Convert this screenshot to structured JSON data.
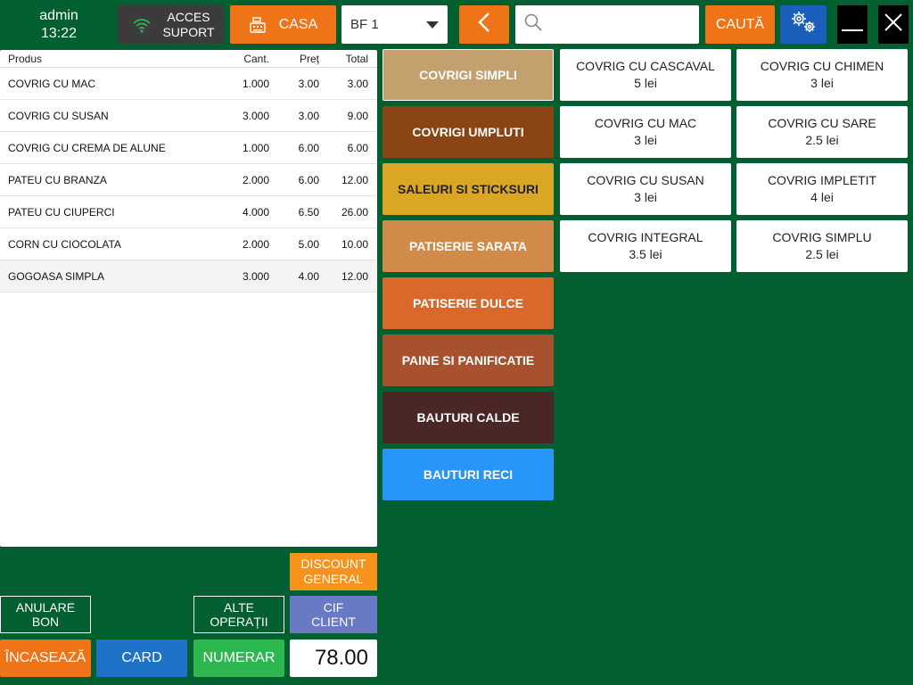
{
  "header": {
    "user": "admin",
    "time": "13:22",
    "acces_label_1": "ACCES",
    "acces_label_2": "SUPORT",
    "casa_label": "CASA",
    "bf_value": "BF 1",
    "search_placeholder": "",
    "search_label": "CAUTĂ"
  },
  "receipt": {
    "columns": {
      "product": "Produs",
      "qty": "Cant.",
      "price": "Preț",
      "total": "Total"
    },
    "rows": [
      {
        "name": "COVRIG CU MAC",
        "qty": "1.000",
        "price": "3.00",
        "total": "3.00"
      },
      {
        "name": "COVRIG CU SUSAN",
        "qty": "3.000",
        "price": "3.00",
        "total": "9.00"
      },
      {
        "name": "COVRIG CU CREMA DE ALUNE",
        "qty": "1.000",
        "price": "6.00",
        "total": "6.00"
      },
      {
        "name": "PATEU CU BRANZA",
        "qty": "2.000",
        "price": "6.00",
        "total": "12.00"
      },
      {
        "name": "PATEU CU CIUPERCI",
        "qty": "4.000",
        "price": "6.50",
        "total": "26.00"
      },
      {
        "name": "CORN CU CIOCOLATA",
        "qty": "2.000",
        "price": "5.00",
        "total": "10.00"
      },
      {
        "name": "GOGOASA SIMPLA",
        "qty": "3.000",
        "price": "4.00",
        "total": "12.00"
      }
    ],
    "grand_total": "78.00"
  },
  "actions": {
    "discount_1": "DISCOUNT",
    "discount_2": "GENERAL",
    "anulare_1": "ANULARE",
    "anulare_2": "BON",
    "alte_1": "ALTE",
    "alte_2": "OPERAȚII",
    "cif_1": "CIF",
    "cif_2": "CLIENT",
    "incaseaza": "ÎNCASEAZĂ",
    "card": "CARD",
    "numerar": "NUMERAR"
  },
  "categories": [
    {
      "label": "COVRIGI SIMPLI",
      "color": "#c4a06f"
    },
    {
      "label": "COVRIGI UMPLUTI",
      "color": "#8b4414"
    },
    {
      "label": "SALEURI SI STICKSURI",
      "color": "#dba624"
    },
    {
      "label": "PATISERIE SARATA",
      "color": "#d28a48"
    },
    {
      "label": "PATISERIE DULCE",
      "color": "#d8692a"
    },
    {
      "label": "PAINE SI PANIFICATIE",
      "color": "#a7512f"
    },
    {
      "label": "BAUTURI CALDE",
      "color": "#4a2626"
    },
    {
      "label": "BAUTURI RECI",
      "color": "#2895f8"
    }
  ],
  "products": [
    {
      "name": "COVRIG CU CASCAVAL",
      "price": "5 lei"
    },
    {
      "name": "COVRIG CU CHIMEN",
      "price": "3 lei"
    },
    {
      "name": "COVRIG CU MAC",
      "price": "3 lei"
    },
    {
      "name": "COVRIG CU SARE",
      "price": "2.5 lei"
    },
    {
      "name": "COVRIG CU SUSAN",
      "price": "3 lei"
    },
    {
      "name": "COVRIG IMPLETIT",
      "price": "4 lei"
    },
    {
      "name": "COVRIG INTEGRAL",
      "price": "3.5 lei"
    },
    {
      "name": "COVRIG SIMPLU",
      "price": "2.5 lei"
    }
  ],
  "icons": {
    "wifi": "wifi-icon",
    "register": "cash-register-icon",
    "dropdown": "caret-down-icon",
    "back": "chevron-left-icon",
    "search": "search-icon",
    "settings": "gears-icon",
    "minimize": "minimize-icon",
    "close": "close-icon"
  },
  "colors": {
    "background": "#025f2f",
    "orange": "#ef7317",
    "blue": "#1e73c9",
    "green": "#2db84f"
  }
}
